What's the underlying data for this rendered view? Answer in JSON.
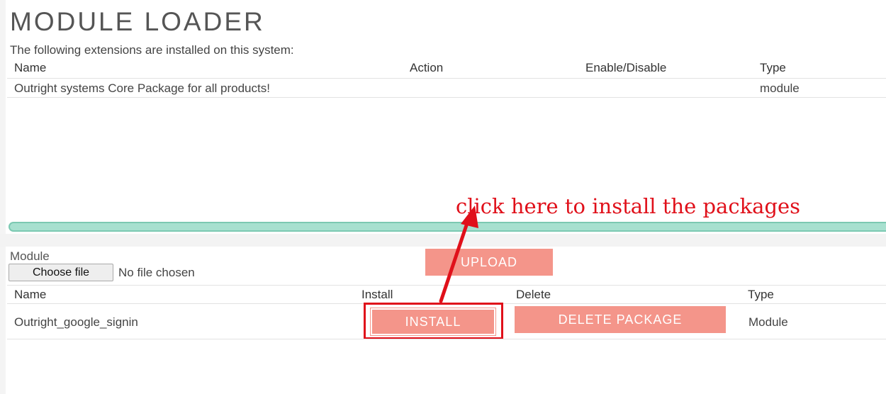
{
  "page": {
    "title": "MODULE LOADER"
  },
  "installed": {
    "intro": "The following extensions are installed on this system:",
    "headers": {
      "name": "Name",
      "action": "Action",
      "enable": "Enable/Disable",
      "type": "Type"
    },
    "rows": [
      {
        "name": "Outright systems Core Package for all products!",
        "type": "module"
      }
    ]
  },
  "upload": {
    "module_label": "Module",
    "choose_file": "Choose file",
    "no_file": "No file chosen",
    "upload_button": "UPLOAD"
  },
  "packages": {
    "headers": {
      "name": "Name",
      "install": "Install",
      "delete": "Delete",
      "type": "Type"
    },
    "rows": [
      {
        "name": "Outright_google_signin",
        "install": "INSTALL",
        "delete": "DELETE PACKAGE",
        "type": "Module"
      }
    ]
  },
  "annotation": {
    "text": "click here to install the packages",
    "color": "#e0101a"
  },
  "colors": {
    "button": "#f4958a",
    "scrollbar": "#a7e0cf",
    "highlight": "#e0101a"
  }
}
